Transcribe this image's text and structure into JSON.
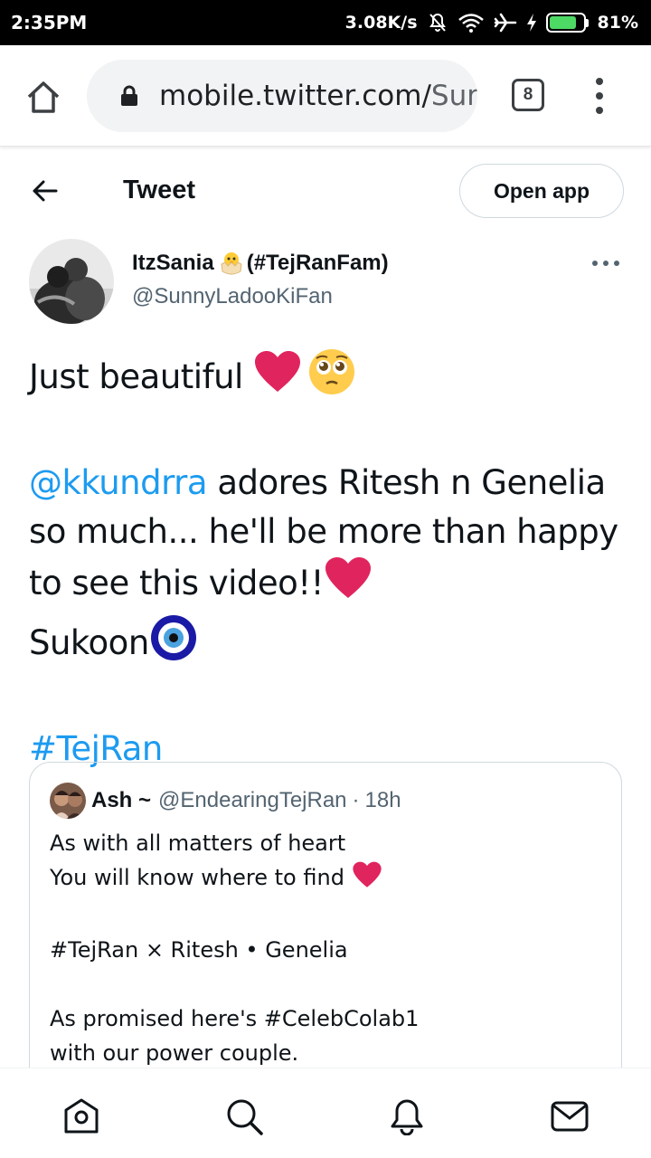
{
  "status_bar": {
    "time": "2:35PM",
    "network_speed": "3.08K/s",
    "battery_percent": "81%",
    "battery_level": 0.81,
    "icons": [
      "mute-icon",
      "wifi-icon",
      "airplane-icon",
      "charging-icon",
      "battery-icon"
    ]
  },
  "browser": {
    "url_main": "mobile.twitter.com/",
    "url_dim": "Sur",
    "tab_count": "8"
  },
  "header": {
    "title": "Tweet",
    "open_app_label": "Open app"
  },
  "tweet": {
    "author_name": "ItzSania",
    "author_name_suffix": "(#TejRanFam)",
    "author_handle": "@SunnyLadooKiFan",
    "line1": "Just beautiful ",
    "mention": "@kkundrra",
    "body_rest": " adores Ritesh n Genelia so much... he'll be more than happy to see this video!!",
    "sukoon": "Sukoon",
    "hashtag": "#TejRan"
  },
  "quote": {
    "name": "Ash ~",
    "handle": "@EndearingTejRan",
    "separator": "·",
    "time": "18h",
    "lines": [
      "As with all matters of heart",
      "You will know where to find ",
      "",
      "#TejRan × Ritesh • Genelia",
      "",
      "As promised here's #CelebColab1",
      "with our power couple."
    ]
  },
  "colors": {
    "link": "#1d9bf0",
    "secondary_text": "#536471",
    "heart": "#e0245e",
    "border": "#cfd9de"
  }
}
